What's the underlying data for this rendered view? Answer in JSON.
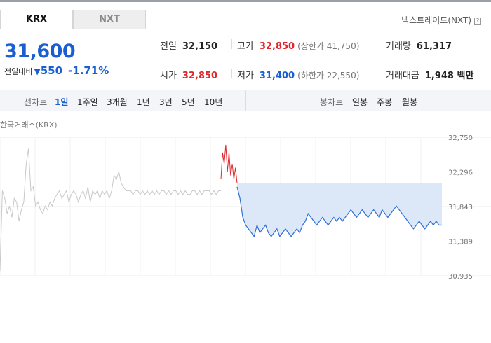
{
  "tabs": {
    "krx": "KRX",
    "nxt": "NXT"
  },
  "nxt_link": "넥스트레이드(NXT)",
  "price": "31,600",
  "change": {
    "label": "전일대비",
    "amount": "550",
    "percent": "-1.71%"
  },
  "stats": {
    "prev_close": {
      "label": "전일",
      "value": "32,150"
    },
    "high": {
      "label": "고가",
      "value": "32,850",
      "sub": "(상한가 41,750)"
    },
    "volume": {
      "label": "거래량",
      "value": "61,317"
    },
    "open": {
      "label": "시가",
      "value": "32,850"
    },
    "low": {
      "label": "저가",
      "value": "31,400",
      "sub": "(하한가 22,550)"
    },
    "trade_value": {
      "label": "거래대금",
      "value": "1,948 백만"
    }
  },
  "periods": {
    "head": "선차트",
    "items": [
      "1일",
      "1주일",
      "3개월",
      "1년",
      "3년",
      "5년",
      "10년"
    ],
    "active": "1일"
  },
  "candles": {
    "head": "봉차트",
    "items": [
      "일봉",
      "주봉",
      "월봉"
    ]
  },
  "market_label": "한국거래소(KRX)",
  "chart_data": {
    "type": "line",
    "y_ticks": [
      "32,750",
      "32,296",
      "31,843",
      "31,389",
      "30,935"
    ],
    "ylim": [
      30935,
      32750
    ],
    "prev_close": 32150,
    "colors": {
      "history": "#c8c8c8",
      "up": "#e0262b",
      "down": "#2e6fd6",
      "fill": "#dce8f8"
    },
    "history": [
      31000,
      32050,
      31950,
      31750,
      31850,
      31700,
      31950,
      31900,
      31650,
      31800,
      31900,
      32400,
      32600,
      32050,
      32100,
      31850,
      31900,
      31800,
      31750,
      31850,
      31800,
      31900,
      31850,
      31950,
      32000,
      32050,
      31950,
      32000,
      32050,
      31900,
      32000,
      32050,
      32000,
      31900,
      32000,
      32050,
      31950,
      32100,
      31900,
      32050,
      32000,
      32050,
      31950,
      32050,
      32000,
      32050,
      31950,
      32050,
      32250,
      32200,
      32300,
      32150,
      32100,
      32050,
      32050,
      32050,
      32000,
      32050,
      32050,
      32000,
      32050,
      32000,
      32050,
      32000,
      32050,
      32000,
      32050,
      32000,
      32050,
      32050,
      32000,
      32050,
      32000,
      32050,
      32050,
      32000,
      32050,
      32000,
      32050,
      32000,
      32000,
      32050,
      32050,
      32000,
      32050,
      32000,
      32050,
      32050,
      32050,
      32000,
      32050,
      32000,
      32050,
      32050
    ],
    "up_segment": [
      32200,
      32550,
      32400,
      32650,
      32300,
      32550,
      32250,
      32400,
      32200,
      32350,
      32150
    ],
    "down_segment": [
      32100,
      31950,
      31700,
      31600,
      31550,
      31500,
      31450,
      31600,
      31500,
      31550,
      31600,
      31500,
      31450,
      31500,
      31550,
      31450,
      31500,
      31550,
      31500,
      31450,
      31500,
      31550,
      31500,
      31600,
      31650,
      31750,
      31700,
      31650,
      31600,
      31650,
      31700,
      31650,
      31600,
      31650,
      31700,
      31650,
      31700,
      31650,
      31700,
      31750,
      31800,
      31750,
      31700,
      31750,
      31800,
      31750,
      31700,
      31750,
      31800,
      31750,
      31700,
      31800,
      31750,
      31700,
      31750,
      31800,
      31850,
      31800,
      31750,
      31700,
      31650,
      31600,
      31550,
      31600,
      31650,
      31600,
      31550,
      31600,
      31650,
      31600,
      31650,
      31600,
      31600
    ]
  }
}
